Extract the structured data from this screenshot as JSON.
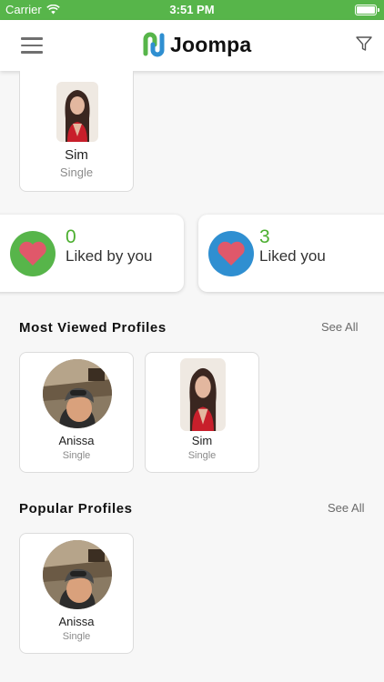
{
  "status_bar": {
    "carrier": "Carrier",
    "time": "3:51 PM"
  },
  "app": {
    "title": "Joompa"
  },
  "featured_profile": {
    "name": "Sim",
    "status": "Single"
  },
  "stats": {
    "liked_by_you": {
      "count": "0",
      "label": "Liked by you"
    },
    "liked_you": {
      "count": "3",
      "label": "Liked you"
    }
  },
  "sections": {
    "most_viewed": {
      "title": "Most Viewed Profiles",
      "see_all": "See All",
      "profiles": [
        {
          "name": "Anissa",
          "status": "Single"
        },
        {
          "name": "Sim",
          "status": "Single"
        }
      ]
    },
    "popular": {
      "title": "Popular Profiles",
      "see_all": "See All",
      "profiles": [
        {
          "name": "Anissa",
          "status": "Single"
        }
      ]
    }
  },
  "icons": {
    "menu": "hamburger-menu-icon",
    "filter": "filter-funnel-icon",
    "heart": "heart-icon",
    "wifi": "wifi-icon",
    "battery": "battery-icon"
  },
  "colors": {
    "brand_green": "#57b54a",
    "liked_blue": "#2f8fd1",
    "heart_red": "#e0586a",
    "count_green": "#4caf30"
  }
}
